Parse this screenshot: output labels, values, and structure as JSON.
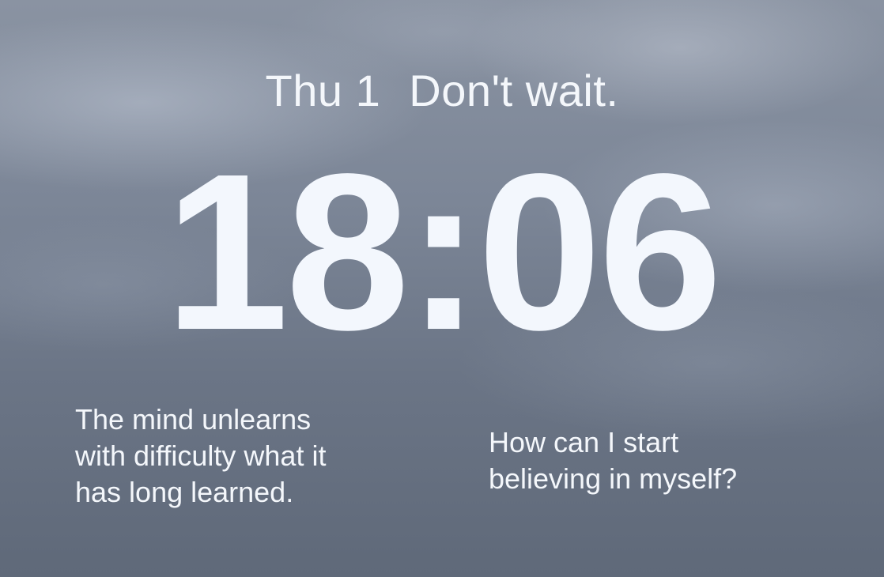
{
  "lock_screen": {
    "date": "Thu 1",
    "top_widget": "Don't wait.",
    "time": "18:06"
  },
  "widgets": {
    "quote": {
      "lines": [
        "The mind unlearns",
        "with difficulty what it",
        "has long learned."
      ]
    },
    "question": {
      "lines": [
        "How can I start",
        "believing in myself?"
      ]
    }
  },
  "colors": {
    "text": "#f4f7fb",
    "sky_top": "#8a93a2",
    "sky_bottom": "#5f6979"
  }
}
